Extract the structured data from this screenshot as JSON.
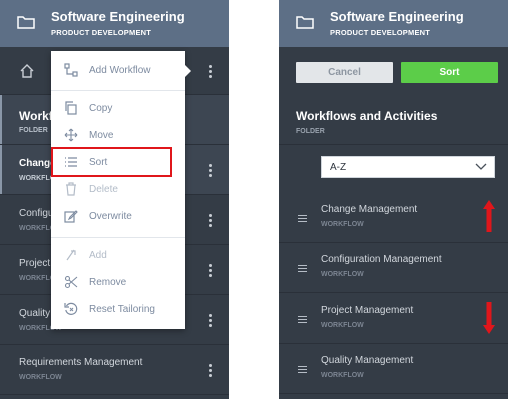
{
  "header": {
    "title": "Software Engineering",
    "subtitle": "PRODUCT DEVELOPMENT"
  },
  "left": {
    "items": [
      {
        "title": "Workflows",
        "subtitle": "FOLDER"
      },
      {
        "title": "Change",
        "subtitle": "WORKFLOW"
      },
      {
        "title": "Configu",
        "subtitle": "WORKFLOW"
      },
      {
        "title": "Project",
        "subtitle": "WORKFLOW"
      },
      {
        "title": "Quality",
        "subtitle": "WORKFLOW"
      },
      {
        "title": "Requirements Management",
        "subtitle": "WORKFLOW"
      }
    ]
  },
  "menu": {
    "items": [
      {
        "label": "Add Workflow",
        "icon": "add-workflow-icon"
      },
      {
        "label": "Copy",
        "icon": "copy-icon"
      },
      {
        "label": "Move",
        "icon": "move-icon"
      },
      {
        "label": "Sort",
        "icon": "sort-icon"
      },
      {
        "label": "Delete",
        "icon": "delete-icon"
      },
      {
        "label": "Overwrite",
        "icon": "overwrite-icon"
      },
      {
        "label": "Add",
        "icon": "add-icon"
      },
      {
        "label": "Remove",
        "icon": "remove-icon"
      },
      {
        "label": "Reset Tailoring",
        "icon": "reset-tailoring-icon"
      }
    ],
    "highlighted": "Sort",
    "highlight_color": "#e0161b"
  },
  "right": {
    "cancel_label": "Cancel",
    "sort_label": "Sort",
    "section_title": "Workflows and Activities",
    "section_subtitle": "FOLDER",
    "sort_order": "A-Z",
    "items": [
      {
        "title": "Change Management",
        "subtitle": "WORKFLOW"
      },
      {
        "title": "Configuration Management",
        "subtitle": "WORKFLOW"
      },
      {
        "title": "Project Management",
        "subtitle": "WORKFLOW"
      },
      {
        "title": "Quality Management",
        "subtitle": "WORKFLOW"
      }
    ],
    "annotation_arrows": [
      "up",
      "down"
    ]
  },
  "colors": {
    "panel": "#343c46",
    "header": "#5d6f86",
    "sort_button": "#5ccd49",
    "annotation": "#e0161b"
  }
}
